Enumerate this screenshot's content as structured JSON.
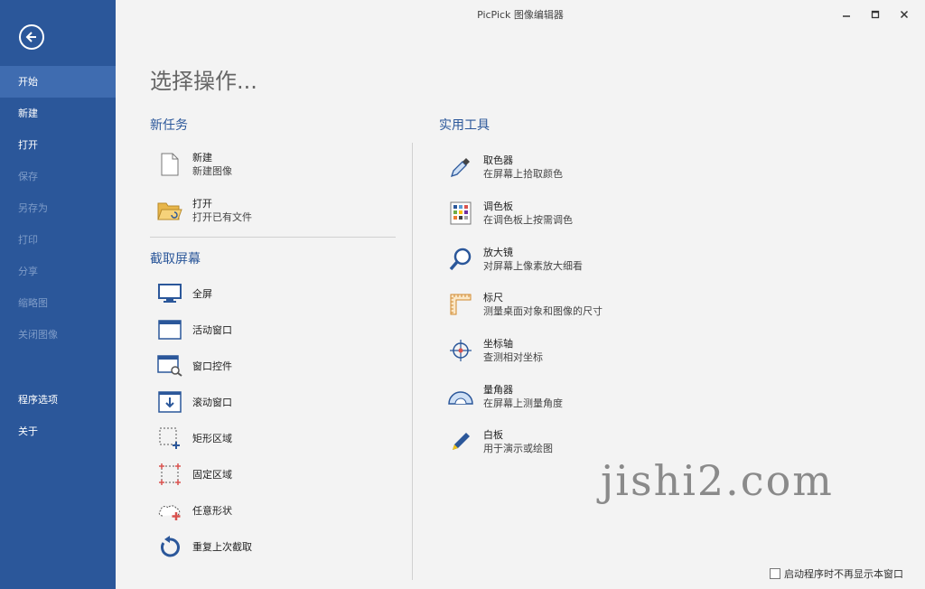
{
  "window": {
    "title": "PicPick 图像编辑器"
  },
  "sidebar": {
    "items": [
      {
        "label": "开始"
      },
      {
        "label": "新建"
      },
      {
        "label": "打开"
      },
      {
        "label": "保存"
      },
      {
        "label": "另存为"
      },
      {
        "label": "打印"
      },
      {
        "label": "分享"
      },
      {
        "label": "缩略图"
      },
      {
        "label": "关闭图像"
      }
    ],
    "lower_items": [
      {
        "label": "程序选项"
      },
      {
        "label": "关于"
      }
    ]
  },
  "main": {
    "heading": "选择操作...",
    "new_task": {
      "title": "新任务",
      "items": [
        {
          "title": "新建",
          "desc": "新建图像"
        },
        {
          "title": "打开",
          "desc": "打开已有文件"
        }
      ]
    },
    "capture": {
      "title": "截取屏幕",
      "items": [
        {
          "label": "全屏"
        },
        {
          "label": "活动窗口"
        },
        {
          "label": "窗口控件"
        },
        {
          "label": "滚动窗口"
        },
        {
          "label": "矩形区域"
        },
        {
          "label": "固定区域"
        },
        {
          "label": "任意形状"
        },
        {
          "label": "重复上次截取"
        }
      ]
    },
    "tools": {
      "title": "实用工具",
      "items": [
        {
          "title": "取色器",
          "desc": "在屏幕上拾取颜色"
        },
        {
          "title": "调色板",
          "desc": "在调色板上按需调色"
        },
        {
          "title": "放大镜",
          "desc": "对屏幕上像素放大细看"
        },
        {
          "title": "标尺",
          "desc": "测量桌面对象和图像的尺寸"
        },
        {
          "title": "坐标轴",
          "desc": "查测相对坐标"
        },
        {
          "title": "量角器",
          "desc": "在屏幕上测量角度"
        },
        {
          "title": "白板",
          "desc": "用于演示或绘图"
        }
      ]
    }
  },
  "footer": {
    "checkbox_label": "启动程序时不再显示本窗口",
    "checked": false
  },
  "watermark": "jishi2.com",
  "colors": {
    "sidebar": "#2b579a",
    "accent": "#2b579a",
    "background": "#f3f3f3"
  }
}
